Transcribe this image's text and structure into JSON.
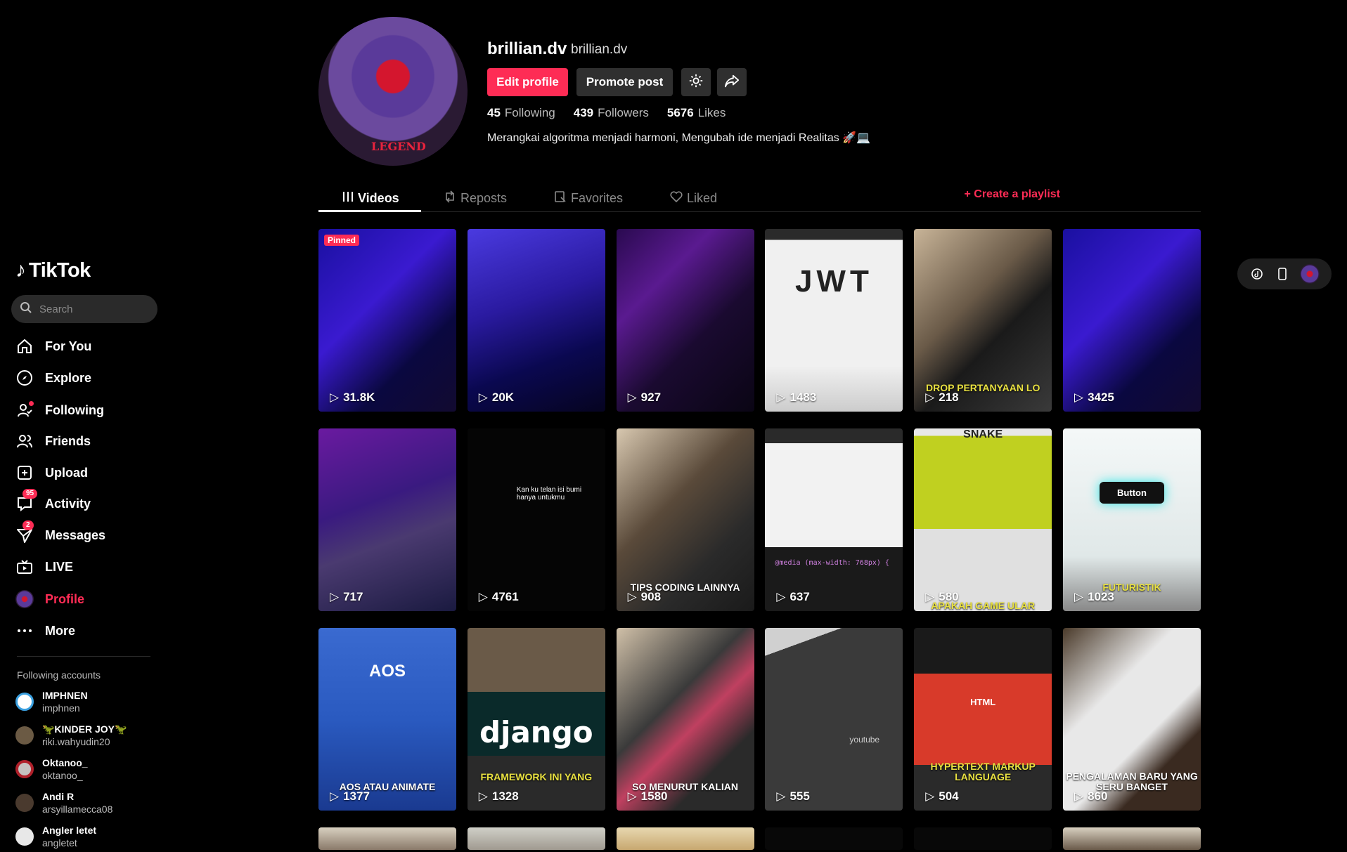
{
  "brand": {
    "name": "TikTok"
  },
  "search": {
    "placeholder": "Search"
  },
  "nav": [
    {
      "label": "For You"
    },
    {
      "label": "Explore"
    },
    {
      "label": "Following"
    },
    {
      "label": "Friends"
    },
    {
      "label": "Upload"
    },
    {
      "label": "Activity",
      "badge": "95"
    },
    {
      "label": "Messages",
      "badge": "2"
    },
    {
      "label": "LIVE"
    },
    {
      "label": "Profile"
    },
    {
      "label": "More"
    }
  ],
  "following_accounts": {
    "title": "Following accounts",
    "items": [
      {
        "name": "IMPHNEN",
        "username": "imphnen"
      },
      {
        "name": "🦖KINDER JOY🦖",
        "username": "riki.wahyudin20"
      },
      {
        "name": "Oktanoo_",
        "username": "oktanoo_"
      },
      {
        "name": "Andi R",
        "username": "arsyillamecca08"
      },
      {
        "name": "Angler letet",
        "username": "angletet"
      }
    ]
  },
  "profile": {
    "username": "brillian.dv",
    "nickname": "brillian.dv",
    "avatar_text": "LEGEND",
    "edit_label": "Edit profile",
    "promote_label": "Promote post",
    "stats": {
      "following": "45",
      "following_label": "Following",
      "followers": "439",
      "followers_label": "Followers",
      "likes": "5676",
      "likes_label": "Likes"
    },
    "bio": "Merangkai algoritma menjadi harmoni, Mengubah ide menjadi Realitas 🚀💻"
  },
  "tabs": {
    "videos": "Videos",
    "reposts": "Reposts",
    "favorites": "Favorites",
    "liked": "Liked",
    "create_playlist": "+ Create a playlist"
  },
  "videos": [
    {
      "views": "31.8K",
      "pinned": "Pinned",
      "overlay": ""
    },
    {
      "views": "20K",
      "overlay": ""
    },
    {
      "views": "927",
      "overlay": ""
    },
    {
      "views": "1483",
      "overlay": "JWT"
    },
    {
      "views": "218",
      "overlay": "DROP PERTANYAAN LO"
    },
    {
      "views": "3425",
      "overlay": ""
    },
    {
      "views": "717",
      "overlay": ""
    },
    {
      "views": "4761",
      "overlay": "Kan ku telan isi bumi hanya untukmu"
    },
    {
      "views": "908",
      "overlay": "TIPS CODING LAINNYA"
    },
    {
      "views": "637",
      "overlay": "@media (max-width: 768px) {"
    },
    {
      "views": "580",
      "overlay": "SNAKE",
      "caption": "APAKAH GAME ULAR"
    },
    {
      "views": "1023",
      "overlay": "Button",
      "caption": "FUTURISTIK"
    },
    {
      "views": "1377",
      "overlay": "AOS",
      "caption": "AOS ATAU ANIMATE"
    },
    {
      "views": "1328",
      "overlay": "django",
      "caption": "FRAMEWORK INI YANG"
    },
    {
      "views": "1580",
      "overlay": "",
      "caption": "SO MENURUT KALIAN"
    },
    {
      "views": "555",
      "overlay": "youtube"
    },
    {
      "views": "504",
      "overlay": "HTML",
      "caption": "HYPERTEXT MARKUP LANGUAGE"
    },
    {
      "views": "860",
      "overlay": "",
      "caption": "PENGALAMAN BARU YANG SERU BANGET"
    }
  ],
  "colors": {
    "accent": "#fe2c55",
    "bg": "#000000",
    "button": "#2f2f2f"
  }
}
